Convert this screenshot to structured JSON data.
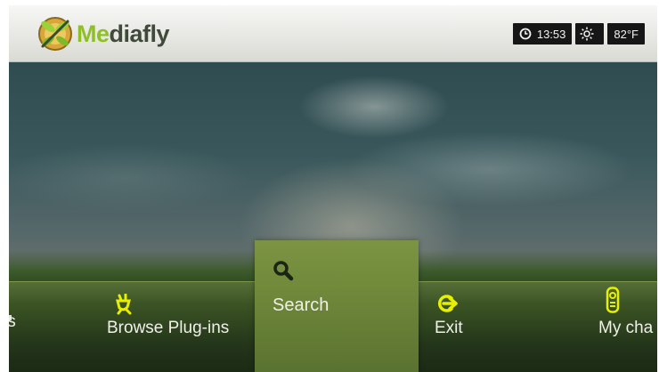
{
  "header": {
    "logo_prefix": "Me",
    "logo_suffix": "diafly",
    "time": "13:53",
    "temperature": "82°F"
  },
  "icons": {
    "logo": "dragonfly-logo-icon",
    "clock": "clock-icon",
    "weather": "sun-icon",
    "browse": "plug-icon",
    "search": "magnifier-icon",
    "exit": "exit-arrow-icon",
    "my_channels": "remote-icon"
  },
  "colors": {
    "accent": "#8fbf27",
    "icon_yellow": "#e7f000",
    "selected_tile": "#6f883a"
  },
  "menu": {
    "items": [
      {
        "label": "ls"
      },
      {
        "label": "Browse Plug-ins"
      },
      {
        "label": "Search",
        "selected": true
      },
      {
        "label": "Exit"
      },
      {
        "label": "My cha"
      }
    ]
  }
}
